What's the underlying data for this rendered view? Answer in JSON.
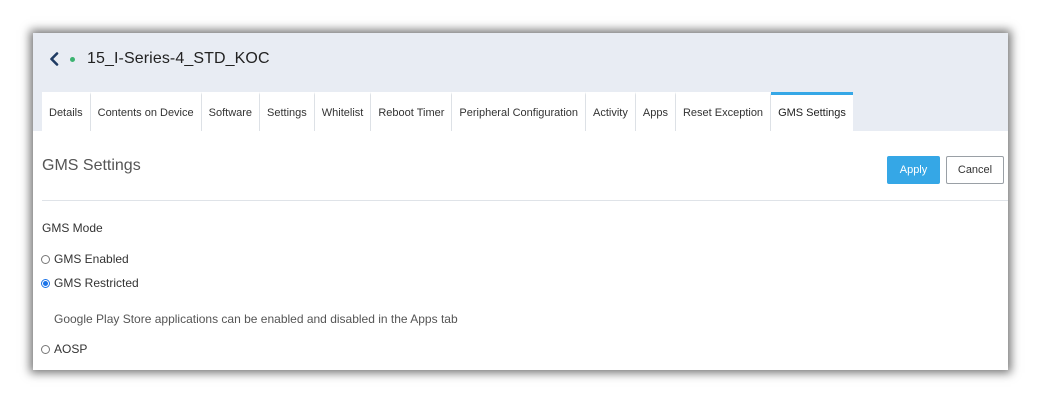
{
  "device": {
    "name": "15_I-Series-4_STD_KOC",
    "status_color": "#3cb371"
  },
  "tabs": [
    {
      "label": "Details"
    },
    {
      "label": "Contents on Device"
    },
    {
      "label": "Software"
    },
    {
      "label": "Settings"
    },
    {
      "label": "Whitelist"
    },
    {
      "label": "Reboot Timer"
    },
    {
      "label": "Peripheral Configuration"
    },
    {
      "label": "Activity"
    },
    {
      "label": "Apps"
    },
    {
      "label": "Reset Exception"
    },
    {
      "label": "GMS Settings",
      "active": true
    }
  ],
  "section": {
    "title": "GMS Settings",
    "apply_label": "Apply",
    "cancel_label": "Cancel"
  },
  "gms_mode": {
    "label": "GMS Mode",
    "options": [
      {
        "label": "GMS Enabled",
        "checked": false
      },
      {
        "label": "GMS Restricted",
        "checked": true
      },
      {
        "label": "AOSP",
        "checked": false
      }
    ],
    "restricted_hint": "Google Play Store applications can be enabled and disabled in the Apps tab"
  },
  "colors": {
    "accent": "#35a7e6",
    "header_bg": "#e8ecf3"
  },
  "icons": {
    "back": "chevron-left-icon",
    "status": "status-dot-icon"
  }
}
